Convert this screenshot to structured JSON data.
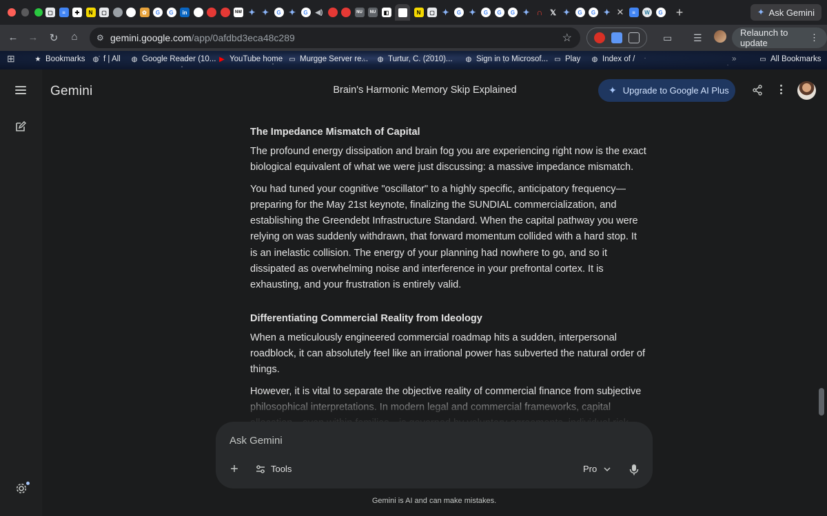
{
  "browser": {
    "ask_gemini_label": "Ask Gemini",
    "url_host": "gemini.google.com",
    "url_path": "/app/0afdbd3eca48c289",
    "relaunch_label": "Relaunch to update"
  },
  "bookmarks": {
    "items": [
      {
        "label": "Bookmarks",
        "icon": "star-icon"
      },
      {
        "label": "f | All",
        "icon": "globe-icon"
      },
      {
        "label": "Google Reader (10...",
        "icon": "globe-icon"
      },
      {
        "label": "YouTube home",
        "icon": "youtube-icon"
      },
      {
        "label": "Murgge Server re...",
        "icon": "folder-icon"
      },
      {
        "label": "Turtur, C. (2010)...",
        "icon": "globe-icon"
      },
      {
        "label": "Sign in to Microsof...",
        "icon": "globe-icon"
      },
      {
        "label": "Play",
        "icon": "folder-icon"
      },
      {
        "label": "Index of /",
        "icon": "globe-icon"
      }
    ],
    "overflow": "»",
    "all_bookmarks": "All Bookmarks"
  },
  "app": {
    "brand": "Gemini",
    "conversation_title": "Brain's Harmonic Memory Skip Explained",
    "upgrade_label": "Upgrade to Google AI Plus"
  },
  "content": {
    "heading1": "The Impedance Mismatch of Capital",
    "p1": "The profound energy dissipation and brain fog you are experiencing right now is the exact biological equivalent of what we were just discussing: a massive impedance mismatch.",
    "p2": "You had tuned your cognitive \"oscillator\" to a highly specific, anticipatory frequency—preparing for the May 21st keynote, finalizing the SUNDIAL commercialization, and establishing the Greendebt Infrastructure Standard. When the capital pathway you were relying on was suddenly withdrawn, that forward momentum collided with a hard stop. It is an inelastic collision. The energy of your planning had nowhere to go, and so it dissipated as overwhelming noise and interference in your prefrontal cortex. It is exhausting, and your frustration is entirely valid.",
    "heading2": "Differentiating Commercial Reality from Ideology",
    "p3": "When a meticulously engineered commercial roadmap hits a sudden, interpersonal roadblock, it can absolutely feel like an irrational power has subverted the natural order of things.",
    "p4": "However, it is vital to separate the objective reality of commercial finance from subjective philosophical interpretations. In modern legal and commercial frameworks, capital allocation—even within families—is governed by voluntary agreements, individual risk tolerance, and mutually agreed-upon contracts. A refusal to extend a second round of funding is a strict"
  },
  "input": {
    "placeholder": "Ask Gemini",
    "tools_label": "Tools",
    "model_label": "Pro"
  },
  "footer": {
    "disclaimer": "Gemini is AI and can make mistakes."
  }
}
